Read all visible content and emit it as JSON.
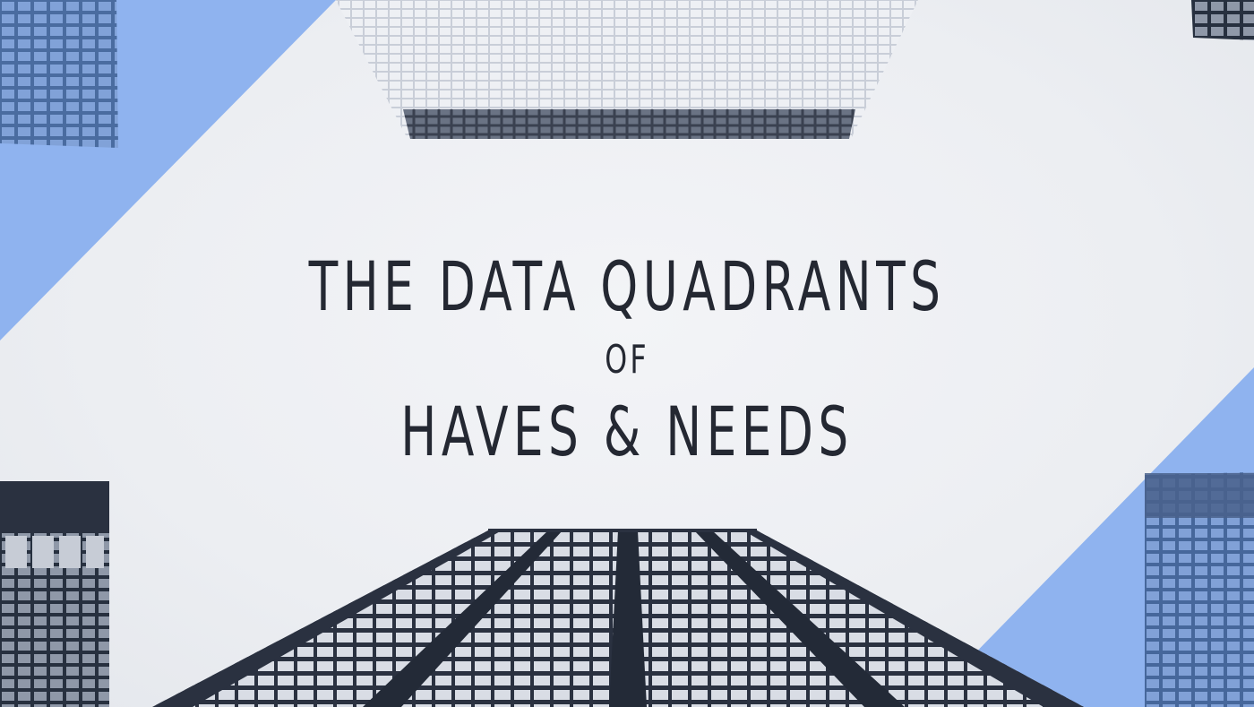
{
  "title": {
    "line1": "THE DATA QUADRANTS",
    "line2": "OF",
    "line3": "HAVES & NEEDS"
  },
  "colors": {
    "background": "#eef0f4",
    "accent_blue": "#8fb3ef",
    "text": "#242832",
    "building_dark": "#2a3140"
  }
}
